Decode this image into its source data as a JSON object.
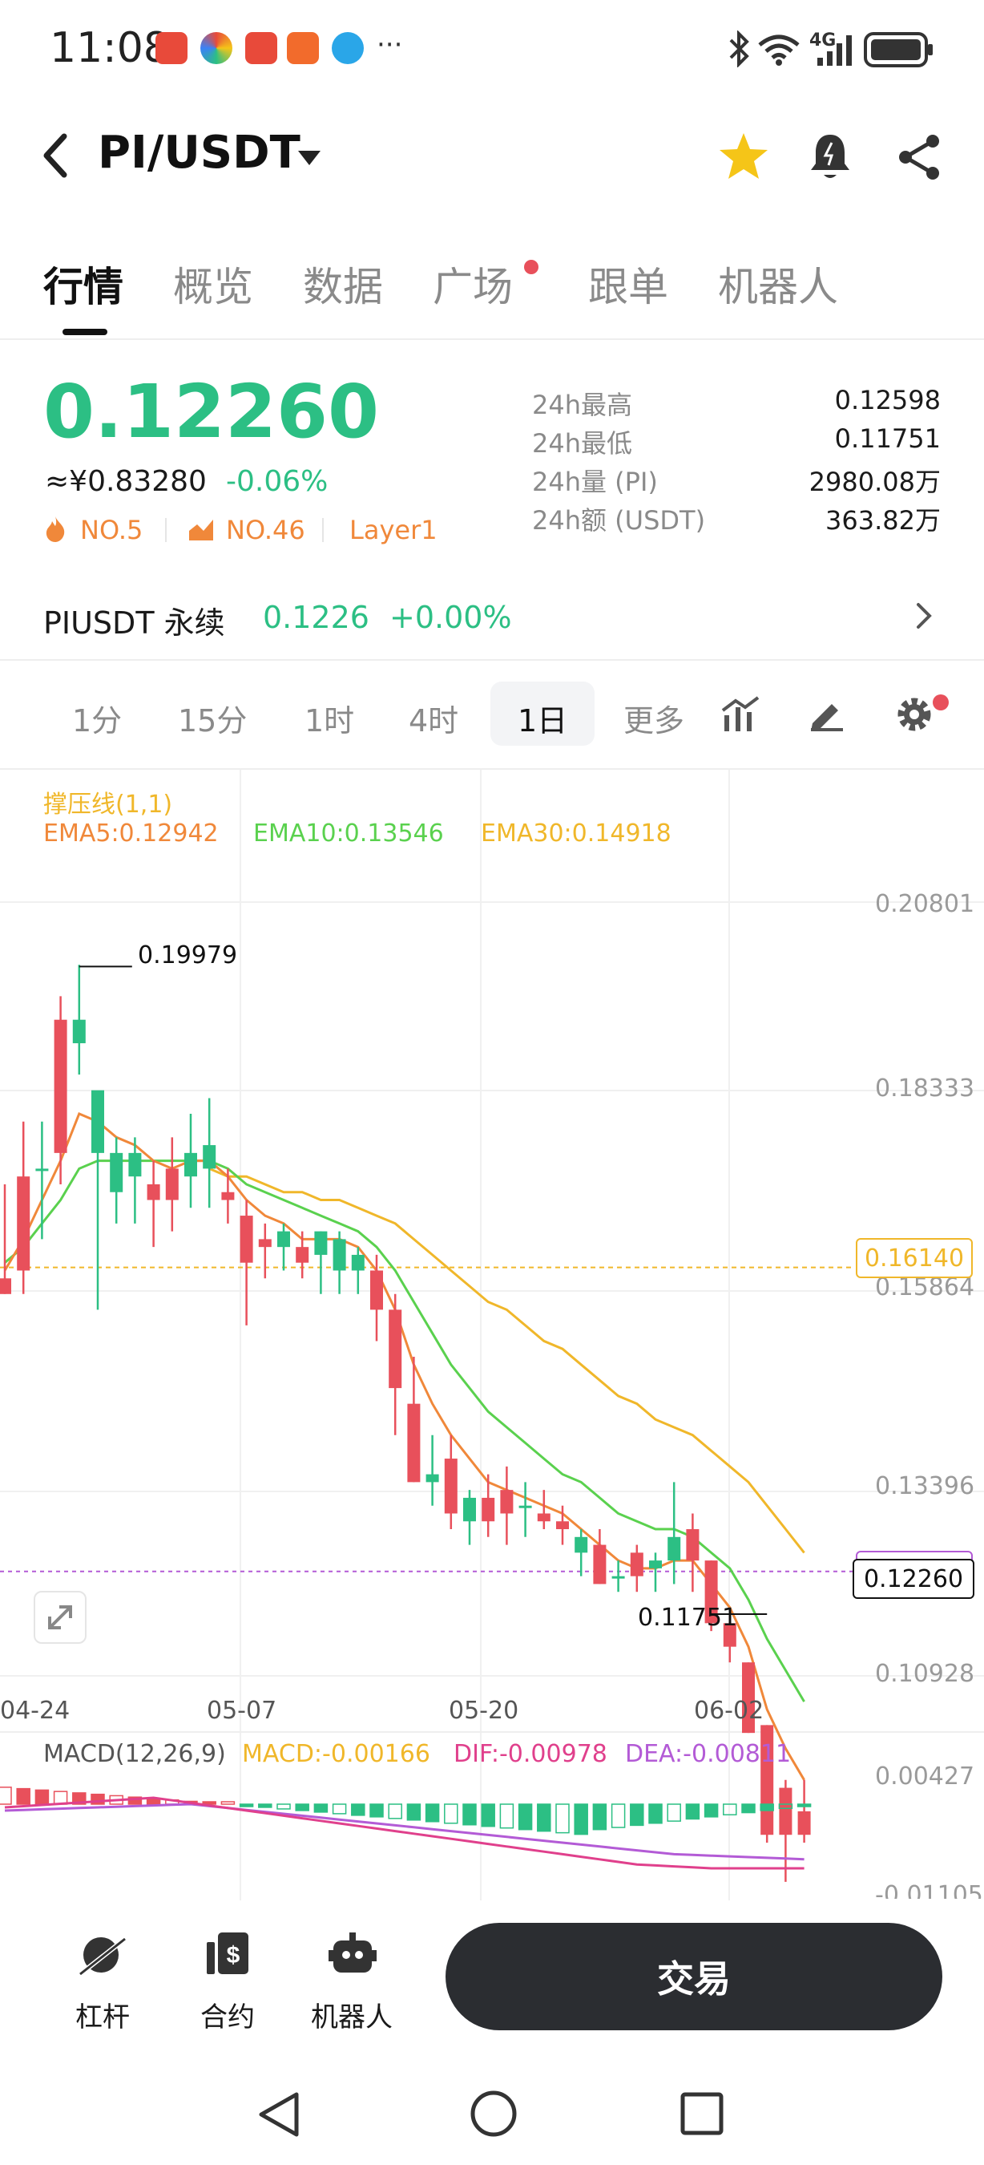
{
  "status_bar": {
    "time": "11:08",
    "more_indicator": "···",
    "network_label": "4G",
    "icons": [
      "app-icon-red-phone",
      "app-icon-multicolor",
      "app-icon-huawei",
      "app-icon-orange",
      "app-icon-blue",
      "bluetooth-icon",
      "wifi-icon",
      "signal-icon",
      "battery-icon"
    ]
  },
  "header": {
    "pair": "PI/USDT",
    "icons": [
      "back-icon",
      "dropdown-icon",
      "star-icon",
      "alert-bell-icon",
      "share-icon"
    ],
    "star_color": "#f5c518"
  },
  "tabs": [
    {
      "label": "行情",
      "active": true
    },
    {
      "label": "概览"
    },
    {
      "label": "数据"
    },
    {
      "label": "广场",
      "dot": true
    },
    {
      "label": "跟单"
    },
    {
      "label": "机器人"
    }
  ],
  "ticker": {
    "price": "0.12260",
    "cny": "≈¥0.83280",
    "change": "-0.06%",
    "rank_hot": "NO.5",
    "rank_gain": "NO.46",
    "tag": "Layer1",
    "stats": [
      {
        "label": "24h最高",
        "value": "0.12598"
      },
      {
        "label": "24h最低",
        "value": "0.11751"
      },
      {
        "label": "24h量 (PI)",
        "value": "2980.08万"
      },
      {
        "label": "24h额 (USDT)",
        "value": "363.82万"
      }
    ]
  },
  "perpetual": {
    "label": "PIUSDT 永续",
    "price": "0.1226",
    "change": "+0.00%"
  },
  "intervals": {
    "items": [
      "1分",
      "15分",
      "1时",
      "4时",
      "1日",
      "更多"
    ],
    "selected": "1日",
    "tool_icons": [
      "indicator-icon",
      "draw-icon",
      "settings-icon"
    ]
  },
  "chart_data": {
    "type": "candlestick",
    "title": "",
    "indicator_label": "撑压线(1,1)",
    "ema_labels": [
      {
        "text": "EMA5:0.12942",
        "color": "#f0883a"
      },
      {
        "text": "EMA10:0.13546",
        "color": "#5ad14e"
      },
      {
        "text": "EMA30:0.14918",
        "color": "#f0b72a"
      }
    ],
    "y_ticks": [
      "0.20801",
      "0.18333",
      "0.15864",
      "0.13396",
      "0.10928"
    ],
    "ylim": [
      0.10928,
      0.20801
    ],
    "x_ticks": [
      "04-24",
      "05-07",
      "05-20",
      "06-02"
    ],
    "high_marker": "0.19979",
    "low_marker": "0.11751",
    "support_line": "0.16140",
    "current_line": "0.12260",
    "candles": [
      {
        "o": 0.16,
        "h": 0.172,
        "l": 0.158,
        "c": 0.158
      },
      {
        "o": 0.173,
        "h": 0.18,
        "l": 0.158,
        "c": 0.161
      },
      {
        "o": 0.174,
        "h": 0.18,
        "l": 0.165,
        "c": 0.174
      },
      {
        "o": 0.193,
        "h": 0.196,
        "l": 0.172,
        "c": 0.176
      },
      {
        "o": 0.19,
        "h": 0.2,
        "l": 0.186,
        "c": 0.193
      },
      {
        "o": 0.176,
        "h": 0.18,
        "l": 0.156,
        "c": 0.184
      },
      {
        "o": 0.171,
        "h": 0.178,
        "l": 0.167,
        "c": 0.176
      },
      {
        "o": 0.173,
        "h": 0.178,
        "l": 0.167,
        "c": 0.176
      },
      {
        "o": 0.172,
        "h": 0.175,
        "l": 0.164,
        "c": 0.17
      },
      {
        "o": 0.174,
        "h": 0.178,
        "l": 0.166,
        "c": 0.17
      },
      {
        "o": 0.173,
        "h": 0.181,
        "l": 0.169,
        "c": 0.176
      },
      {
        "o": 0.174,
        "h": 0.183,
        "l": 0.169,
        "c": 0.177
      },
      {
        "o": 0.171,
        "h": 0.174,
        "l": 0.167,
        "c": 0.17
      },
      {
        "o": 0.168,
        "h": 0.17,
        "l": 0.154,
        "c": 0.162
      },
      {
        "o": 0.165,
        "h": 0.167,
        "l": 0.16,
        "c": 0.164
      },
      {
        "o": 0.164,
        "h": 0.167,
        "l": 0.161,
        "c": 0.166
      },
      {
        "o": 0.164,
        "h": 0.166,
        "l": 0.16,
        "c": 0.162
      },
      {
        "o": 0.163,
        "h": 0.166,
        "l": 0.158,
        "c": 0.166
      },
      {
        "o": 0.161,
        "h": 0.166,
        "l": 0.158,
        "c": 0.165
      },
      {
        "o": 0.161,
        "h": 0.164,
        "l": 0.158,
        "c": 0.163
      },
      {
        "o": 0.161,
        "h": 0.163,
        "l": 0.152,
        "c": 0.156
      },
      {
        "o": 0.156,
        "h": 0.158,
        "l": 0.14,
        "c": 0.146
      },
      {
        "o": 0.144,
        "h": 0.15,
        "l": 0.134,
        "c": 0.134
      },
      {
        "o": 0.134,
        "h": 0.14,
        "l": 0.131,
        "c": 0.135
      },
      {
        "o": 0.137,
        "h": 0.14,
        "l": 0.128,
        "c": 0.13
      },
      {
        "o": 0.129,
        "h": 0.133,
        "l": 0.126,
        "c": 0.132
      },
      {
        "o": 0.132,
        "h": 0.135,
        "l": 0.127,
        "c": 0.129
      },
      {
        "o": 0.133,
        "h": 0.136,
        "l": 0.126,
        "c": 0.13
      },
      {
        "o": 0.131,
        "h": 0.134,
        "l": 0.127,
        "c": 0.131
      },
      {
        "o": 0.13,
        "h": 0.133,
        "l": 0.128,
        "c": 0.129
      },
      {
        "o": 0.129,
        "h": 0.131,
        "l": 0.126,
        "c": 0.128
      },
      {
        "o": 0.125,
        "h": 0.128,
        "l": 0.122,
        "c": 0.127
      },
      {
        "o": 0.126,
        "h": 0.128,
        "l": 0.121,
        "c": 0.121
      },
      {
        "o": 0.122,
        "h": 0.124,
        "l": 0.12,
        "c": 0.122
      },
      {
        "o": 0.125,
        "h": 0.126,
        "l": 0.12,
        "c": 0.122
      },
      {
        "o": 0.123,
        "h": 0.125,
        "l": 0.12,
        "c": 0.124
      },
      {
        "o": 0.124,
        "h": 0.134,
        "l": 0.121,
        "c": 0.127
      },
      {
        "o": 0.128,
        "h": 0.13,
        "l": 0.12,
        "c": 0.124
      },
      {
        "o": 0.124,
        "h": 0.124,
        "l": 0.115,
        "c": 0.116
      },
      {
        "o": 0.116,
        "h": 0.117,
        "l": 0.111,
        "c": 0.113
      },
      {
        "o": 0.111,
        "h": 0.111,
        "l": 0.102,
        "c": 0.102
      },
      {
        "o": 0.103,
        "h": 0.103,
        "l": 0.088,
        "c": 0.089
      },
      {
        "o": 0.095,
        "h": 0.096,
        "l": 0.083,
        "c": 0.089
      },
      {
        "o": 0.092,
        "h": 0.096,
        "l": 0.088,
        "c": 0.089
      }
    ],
    "ema5": [
      0.161,
      0.165,
      0.17,
      0.175,
      0.181,
      0.18,
      0.178,
      0.177,
      0.175,
      0.174,
      0.175,
      0.175,
      0.173,
      0.17,
      0.168,
      0.167,
      0.165,
      0.165,
      0.165,
      0.164,
      0.161,
      0.156,
      0.149,
      0.144,
      0.14,
      0.137,
      0.134,
      0.133,
      0.132,
      0.131,
      0.13,
      0.128,
      0.126,
      0.124,
      0.123,
      0.123,
      0.124,
      0.124,
      0.121,
      0.118,
      0.113,
      0.105,
      0.1,
      0.096
    ],
    "ema10": [
      0.162,
      0.164,
      0.167,
      0.17,
      0.174,
      0.175,
      0.175,
      0.175,
      0.175,
      0.175,
      0.175,
      0.175,
      0.174,
      0.172,
      0.171,
      0.17,
      0.169,
      0.168,
      0.167,
      0.166,
      0.164,
      0.161,
      0.157,
      0.153,
      0.149,
      0.146,
      0.143,
      0.141,
      0.139,
      0.137,
      0.135,
      0.134,
      0.132,
      0.13,
      0.129,
      0.128,
      0.128,
      0.127,
      0.125,
      0.123,
      0.119,
      0.114,
      0.11,
      0.106
    ],
    "ema30": [
      null,
      null,
      null,
      null,
      null,
      null,
      null,
      null,
      null,
      null,
      null,
      0.174,
      0.173,
      0.173,
      0.172,
      0.171,
      0.171,
      0.17,
      0.17,
      0.169,
      0.168,
      0.167,
      0.165,
      0.163,
      0.161,
      0.159,
      0.157,
      0.156,
      0.154,
      0.152,
      0.151,
      0.149,
      0.147,
      0.145,
      0.144,
      0.142,
      0.141,
      0.14,
      0.138,
      0.136,
      0.134,
      0.131,
      0.128,
      0.125
    ],
    "macd": {
      "label": "MACD(12,26,9)",
      "macd_text": "MACD:-0.00166",
      "dif_text": "DIF:-0.00978",
      "dea_text": "DEA:-0.00811",
      "y_ticks": [
        "0.00427",
        "-0.01105"
      ]
    }
  },
  "bottom_nav": {
    "items": [
      {
        "label": "杠杆",
        "icon": "leverage-icon"
      },
      {
        "label": "合约",
        "icon": "contract-icon"
      },
      {
        "label": "机器人",
        "icon": "robot-icon"
      }
    ],
    "trade_button": "交易"
  },
  "system_nav": {
    "icons": [
      "nav-back-icon",
      "nav-home-icon",
      "nav-recents-icon"
    ]
  },
  "colors": {
    "up": "#2cbf84",
    "down": "#e8505b",
    "accent": "#f0883a"
  }
}
